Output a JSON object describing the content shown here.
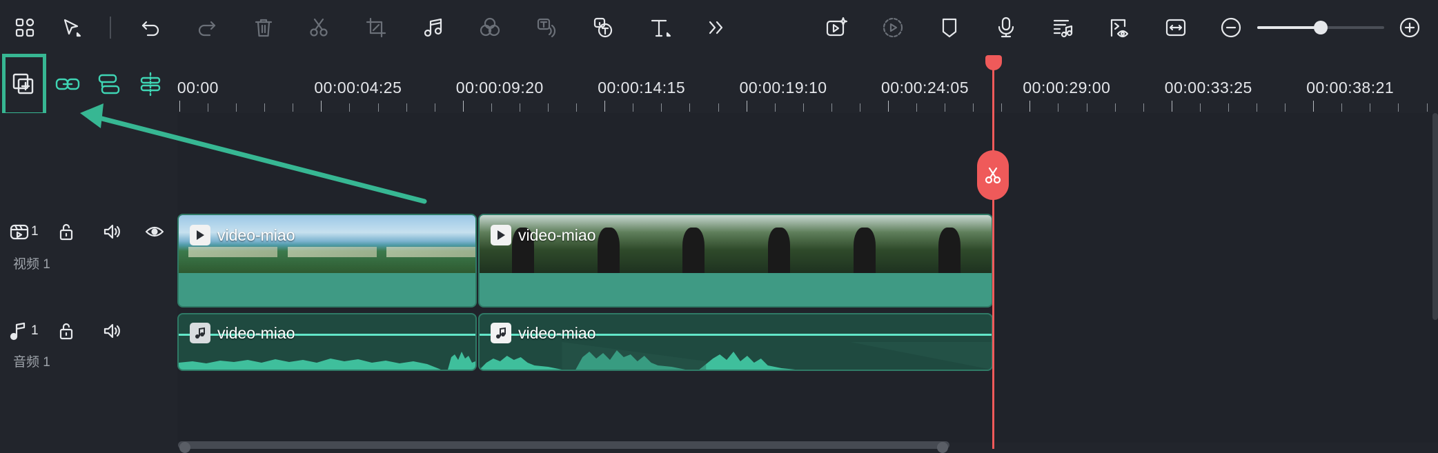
{
  "toolbar": {
    "items": [
      {
        "icon": "layout-grid-icon",
        "enabled": true
      },
      {
        "icon": "select-pointer-icon",
        "enabled": true
      },
      {
        "icon": "undo-icon",
        "enabled": true
      },
      {
        "icon": "redo-icon",
        "enabled": false
      },
      {
        "icon": "delete-icon",
        "enabled": false
      },
      {
        "icon": "cut-icon",
        "enabled": false
      },
      {
        "icon": "crop-icon",
        "enabled": false
      },
      {
        "icon": "audio-note-icon",
        "enabled": true
      },
      {
        "icon": "color-circles-icon",
        "enabled": false
      },
      {
        "icon": "speech-to-text-icon",
        "enabled": false
      },
      {
        "icon": "text-to-speech-icon",
        "enabled": true
      },
      {
        "icon": "text-tool-icon",
        "enabled": true
      },
      {
        "icon": "more-chevron-icon",
        "enabled": true
      }
    ],
    "right_items": [
      {
        "icon": "ai-media-icon",
        "enabled": true
      },
      {
        "icon": "render-preview-icon",
        "enabled": false
      },
      {
        "icon": "marker-icon",
        "enabled": true
      },
      {
        "icon": "microphone-icon",
        "enabled": true
      },
      {
        "icon": "audio-mixer-icon",
        "enabled": true
      },
      {
        "icon": "preview-eye-icon",
        "enabled": true
      },
      {
        "icon": "fit-width-icon",
        "enabled": true
      },
      {
        "icon": "zoom-out-icon",
        "enabled": true
      },
      {
        "icon": "zoom-in-icon",
        "enabled": true
      }
    ],
    "zoom_level": 0.5
  },
  "timeline_tools": [
    {
      "icon": "add-track-icon",
      "highlighted": true
    },
    {
      "icon": "link-clips-icon",
      "highlighted": false
    },
    {
      "icon": "track-group-icon",
      "highlighted": false
    },
    {
      "icon": "magnetic-snap-icon",
      "highlighted": false
    }
  ],
  "ruler": {
    "labels": [
      ":00:00",
      "00:00:04:25",
      "00:00:09:20",
      "00:00:14:15",
      "00:00:19:10",
      "00:00:24:05",
      "00:00:29:00",
      "00:00:33:25",
      "00:00:38:21"
    ]
  },
  "tracks": {
    "video": {
      "number": "1",
      "name": "视频 1"
    },
    "audio": {
      "number": "1",
      "name": "音频 1"
    }
  },
  "clips": {
    "video": [
      {
        "label": "video-miao",
        "thumb": "beach"
      },
      {
        "label": "video-miao",
        "thumb": "forest"
      }
    ],
    "audio": [
      {
        "label": "video-miao"
      },
      {
        "label": "video-miao"
      }
    ]
  },
  "colors": {
    "accent": "#37b793",
    "playhead": "#ef5a5a",
    "video_clip": "#3f9a84",
    "audio_clip": "#1f4a40",
    "waveform": "#3fbf9c"
  }
}
